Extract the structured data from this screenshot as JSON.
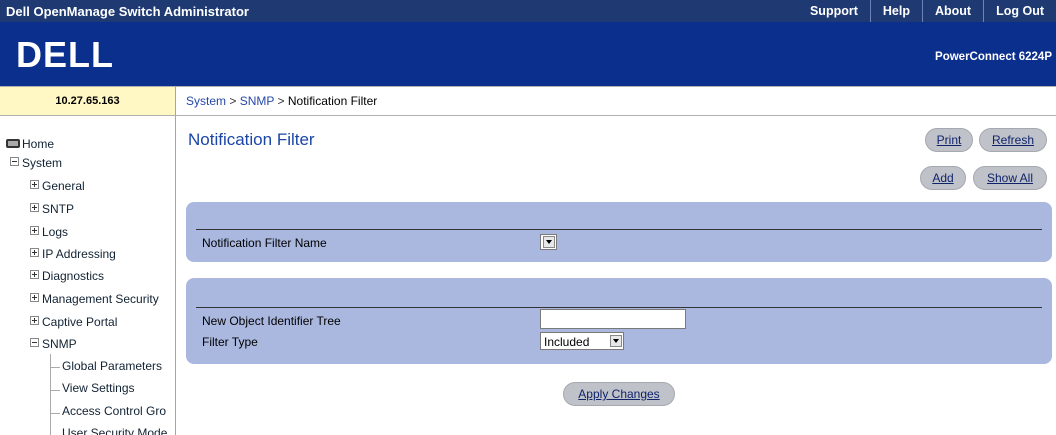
{
  "window_title": "Dell OpenManage Switch Administrator",
  "top_links": [
    "Support",
    "Help",
    "About",
    "Log Out"
  ],
  "brand": {
    "logo_text": "DELL",
    "model": "PowerConnect 6224P"
  },
  "ip_address": "10.27.65.163",
  "breadcrumb": {
    "system": "System",
    "snmp": "SNMP",
    "current": "Notification Filter",
    "sep": ">"
  },
  "sidebar": {
    "home": "Home",
    "system": "System",
    "general": "General",
    "sntp": "SNTP",
    "logs": "Logs",
    "ip_addressing": "IP Addressing",
    "diagnostics": "Diagnostics",
    "management_security": "Management Security",
    "captive_portal": "Captive Portal",
    "snmp": "SNMP",
    "global_parameters": "Global Parameters",
    "view_settings": "View Settings",
    "access_control": "Access Control Gro",
    "user_security": "User Security Mode"
  },
  "page": {
    "title": "Notification Filter",
    "print_label": "Print",
    "refresh_label": "Refresh",
    "add_label": "Add",
    "show_all_label": "Show All",
    "filter_name_label": "Notification Filter Name",
    "filter_name_value": "",
    "new_oid_label": "New Object Identifier Tree",
    "new_oid_value": "",
    "filter_type_label": "Filter Type",
    "filter_type_value": "Included",
    "apply_label": "Apply Changes"
  }
}
